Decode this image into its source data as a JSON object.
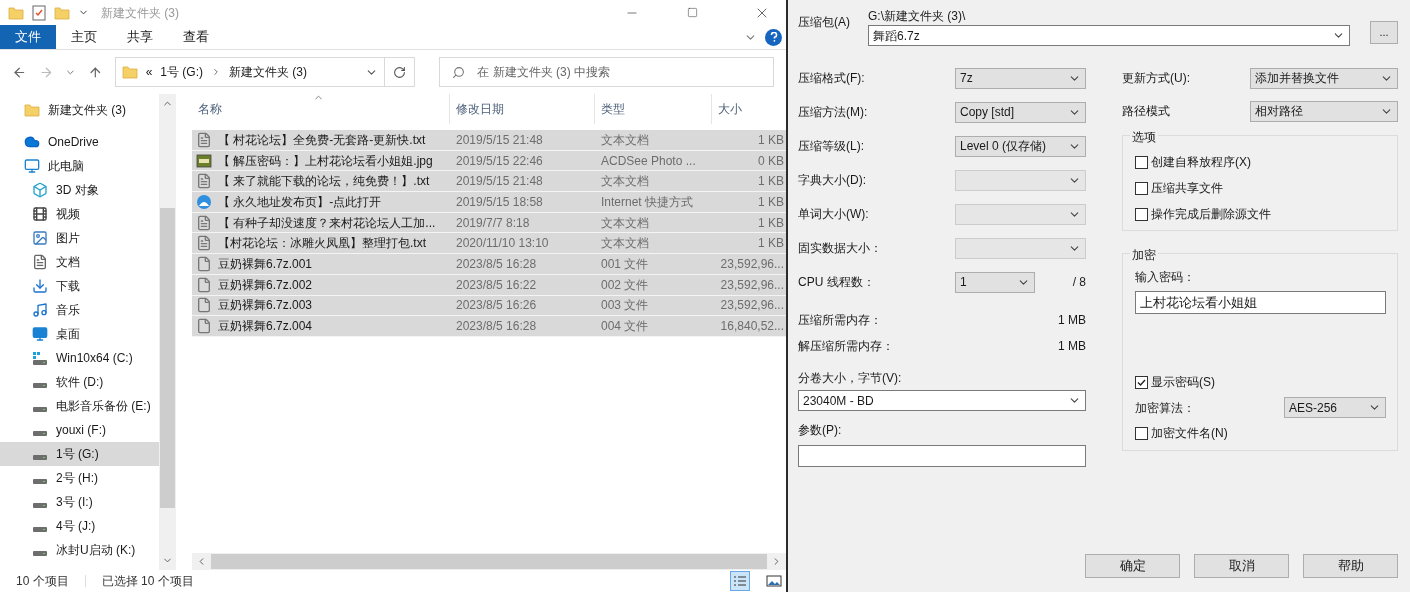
{
  "explorer": {
    "title": "新建文件夹 (3)",
    "ribbon_tabs": [
      {
        "label": "文件",
        "selected": true
      },
      {
        "label": "主页",
        "selected": false
      },
      {
        "label": "共享",
        "selected": false
      },
      {
        "label": "查看",
        "selected": false
      }
    ],
    "address": {
      "overflow": "«",
      "parts": [
        "1号 (G:)",
        "新建文件夹 (3)"
      ]
    },
    "search": {
      "placeholder": "在 新建文件夹 (3) 中搜索"
    },
    "sidebar": [
      {
        "label": "新建文件夹 (3)",
        "kind": "folder",
        "selected": false
      },
      {
        "label": "OneDrive",
        "kind": "cloud",
        "selected": false
      },
      {
        "label": "此电脑",
        "kind": "pc",
        "selected": false,
        "children": [
          {
            "label": "3D 对象",
            "kind": "cube",
            "selected": false
          },
          {
            "label": "视频",
            "kind": "video",
            "selected": false
          },
          {
            "label": "图片",
            "kind": "image",
            "selected": false
          },
          {
            "label": "文档",
            "kind": "doc",
            "selected": false
          },
          {
            "label": "下载",
            "kind": "download",
            "selected": false
          },
          {
            "label": "音乐",
            "kind": "music",
            "selected": false
          },
          {
            "label": "桌面",
            "kind": "desktop",
            "selected": false
          },
          {
            "label": "Win10x64 (C:)",
            "kind": "windrive",
            "selected": false
          },
          {
            "label": "软件 (D:)",
            "kind": "drive",
            "selected": false
          },
          {
            "label": "电影音乐备份 (E:)",
            "kind": "drive",
            "selected": false
          },
          {
            "label": "youxi (F:)",
            "kind": "drive",
            "selected": false
          },
          {
            "label": "1号 (G:)",
            "kind": "drive",
            "selected": true
          },
          {
            "label": "2号 (H:)",
            "kind": "drive",
            "selected": false
          },
          {
            "label": "3号 (I:)",
            "kind": "drive",
            "selected": false
          },
          {
            "label": "4号 (J:)",
            "kind": "drive",
            "selected": false
          },
          {
            "label": "冰封U启动 (K:)",
            "kind": "drive",
            "selected": false
          }
        ]
      }
    ],
    "columns": [
      "名称",
      "修改日期",
      "类型",
      "大小"
    ],
    "rows": [
      {
        "name": "【 村花论坛】全免费-无套路-更新快.txt",
        "date": "2019/5/15 21:48",
        "type": "文本文档",
        "size": "1 KB",
        "kind": "text",
        "selected": true
      },
      {
        "name": "【 解压密码：】上村花论坛看小姐姐.jpg",
        "date": "2019/5/15 22:46",
        "type": "ACDSee Photo ...",
        "size": "0 KB",
        "kind": "jpg",
        "selected": true
      },
      {
        "name": "【 来了就能下载的论坛，纯免费！】.txt",
        "date": "2019/5/15 21:48",
        "type": "文本文档",
        "size": "1 KB",
        "kind": "text",
        "selected": true
      },
      {
        "name": "【 永久地址发布页】-点此打开",
        "date": "2019/5/15 18:58",
        "type": "Internet 快捷方式",
        "size": "1 KB",
        "kind": "link",
        "selected": true
      },
      {
        "name": "【 有种子却没速度？来村花论坛人工加...",
        "date": "2019/7/7 8:18",
        "type": "文本文档",
        "size": "1 KB",
        "kind": "text",
        "selected": true
      },
      {
        "name": "【村花论坛：冰雕火凤凰】整理打包.txt",
        "date": "2020/11/10 13:10",
        "type": "文本文档",
        "size": "1 KB",
        "kind": "text",
        "selected": true
      },
      {
        "name": "豆奶裸舞6.7z.001",
        "date": "2023/8/5 16:28",
        "type": "001 文件",
        "size": "23,592,96...",
        "kind": "blank",
        "selected": true
      },
      {
        "name": "豆奶裸舞6.7z.002",
        "date": "2023/8/5 16:22",
        "type": "002 文件",
        "size": "23,592,96...",
        "kind": "blank",
        "selected": true
      },
      {
        "name": "豆奶裸舞6.7z.003",
        "date": "2023/8/5 16:26",
        "type": "003 文件",
        "size": "23,592,96...",
        "kind": "blank",
        "selected": true
      },
      {
        "name": "豆奶裸舞6.7z.004",
        "date": "2023/8/5 16:28",
        "type": "004 文件",
        "size": "16,840,52...",
        "kind": "blank",
        "selected": true
      }
    ],
    "status_bar": {
      "count": "10 个项目",
      "selection": "已选择 10 个项目"
    }
  },
  "dialog": {
    "archive_label": "压缩包(A)",
    "archive_path": "G:\\新建文件夹 (3)\\",
    "archive_name": "舞蹈6.7z",
    "browse_button": "...",
    "left_fields": [
      {
        "kind": "select",
        "label": "压缩格式(F):",
        "value": "7z",
        "disabled": false
      },
      {
        "kind": "select",
        "label": "压缩方法(M):",
        "value": "Copy [std]",
        "disabled": false
      },
      {
        "kind": "select",
        "label": "压缩等级(L):",
        "value": "Level 0 (仅存储)",
        "disabled": false
      },
      {
        "kind": "select",
        "label": "字典大小(D):",
        "disabled": true
      },
      {
        "kind": "select",
        "label": "单词大小(W):",
        "disabled": true
      },
      {
        "kind": "select",
        "label": "固实数据大小：",
        "disabled": true
      },
      {
        "kind": "threads",
        "label": "CPU 线程数：",
        "value": "1",
        "total": "/ 8",
        "disabled": false
      },
      {
        "kind": "info",
        "label": "压缩所需内存：",
        "value": "1 MB"
      },
      {
        "kind": "info",
        "label": "解压缩所需内存：",
        "value": "1 MB"
      }
    ],
    "volume": {
      "label": "分卷大小，字节(V):",
      "value": "23040M - BD"
    },
    "parameters": {
      "label": "参数(P):"
    },
    "update_mode": {
      "label": "更新方式(U):",
      "value": "添加并替换文件"
    },
    "path_mode": {
      "label": "路径模式",
      "value": "相对路径"
    },
    "options": {
      "title": "选项",
      "items": [
        {
          "label": "创建自释放程序(X)",
          "checked": false
        },
        {
          "label": "压缩共享文件",
          "checked": false
        },
        {
          "label": "操作完成后删除源文件",
          "checked": false
        }
      ]
    },
    "encryption": {
      "title": "加密",
      "password_label": "输入密码：",
      "password": "上村花论坛看小姐姐",
      "show_password": {
        "label": "显示密码(S)",
        "checked": true
      },
      "method_label": "加密算法：",
      "method": "AES-256",
      "encrypt_names": {
        "label": "加密文件名(N)",
        "checked": false
      }
    },
    "buttons": [
      "确定",
      "取消",
      "帮助"
    ]
  }
}
